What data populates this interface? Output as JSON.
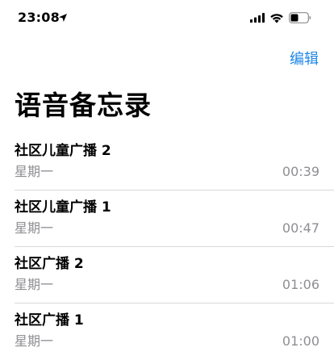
{
  "status_bar": {
    "time": "23:08",
    "icons": [
      "location-arrow-icon",
      "signal-icon",
      "wifi-icon",
      "battery-icon"
    ]
  },
  "header": {
    "edit_label": "编辑",
    "title": "语音备忘录"
  },
  "memos": [
    {
      "title": "社区儿童广播 2",
      "date": "星期一",
      "duration": "00:39"
    },
    {
      "title": "社区儿童广播 1",
      "date": "星期一",
      "duration": "00:47"
    },
    {
      "title": "社区广播 2",
      "date": "星期一",
      "duration": "01:06"
    },
    {
      "title": "社区广播 1",
      "date": "星期一",
      "duration": "01:00"
    }
  ],
  "colors": {
    "accent": "#1f86e8",
    "secondary_text": "#8e8e93",
    "divider": "#d9d9dd"
  }
}
